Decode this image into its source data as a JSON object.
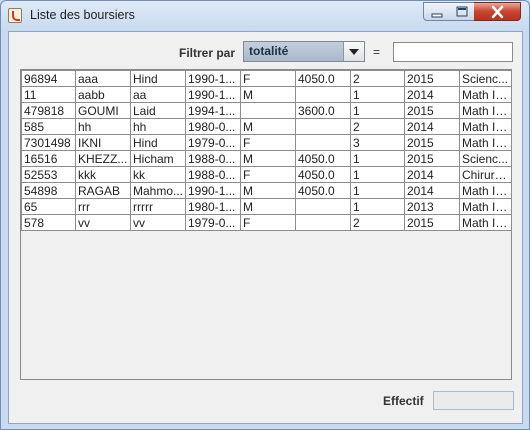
{
  "window": {
    "title": "Liste des boursiers"
  },
  "filter": {
    "label": "Filtrer par",
    "selected": "totalité",
    "equals": "=",
    "value": ""
  },
  "table": {
    "rows": [
      [
        "96894",
        "aaa",
        "Hind",
        "1990-1...",
        "F",
        "4050.0",
        "2",
        "2015",
        "Scienc..."
      ],
      [
        "11",
        "aabb",
        "aa",
        "1990-1...",
        "M",
        "",
        "1",
        "2014",
        "Math Info"
      ],
      [
        "479818",
        "GOUMI",
        "Laid",
        "1994-1...",
        "",
        "3600.0",
        "1",
        "2015",
        "Math Info"
      ],
      [
        "585",
        "hh",
        "hh",
        "1980-0...",
        "M",
        "",
        "2",
        "2014",
        "Math Info"
      ],
      [
        "7301498",
        "IKNI",
        "Hind",
        "1979-0...",
        "F",
        "",
        "3",
        "2015",
        "Math Info"
      ],
      [
        "16516",
        "KHEZZ...",
        "Hicham",
        "1988-0...",
        "M",
        "4050.0",
        "1",
        "2015",
        "Scienc..."
      ],
      [
        "52553",
        "kkk",
        "kk",
        "1988-0...",
        "F",
        "4050.0",
        "1",
        "2014",
        "Chirurg..."
      ],
      [
        "54898",
        "RAGAB",
        "Mahmo...",
        "1990-1...",
        "M",
        "4050.0",
        "1",
        "2014",
        "Math Info"
      ],
      [
        "65",
        "rrr",
        "rrrrr",
        "1980-1...",
        "M",
        "",
        "1",
        "2013",
        "Math Info"
      ],
      [
        "578",
        "vv",
        "vv",
        "1979-0...",
        "F",
        "",
        "2",
        "2015",
        "Math Info"
      ]
    ]
  },
  "footer": {
    "effectif_label": "Effectif",
    "effectif_value": ""
  },
  "icons": {
    "app": "java-cup-icon",
    "minimize": "minimize-icon",
    "maximize": "maximize-icon",
    "close": "close-icon",
    "dropdown": "chevron-down-icon"
  }
}
